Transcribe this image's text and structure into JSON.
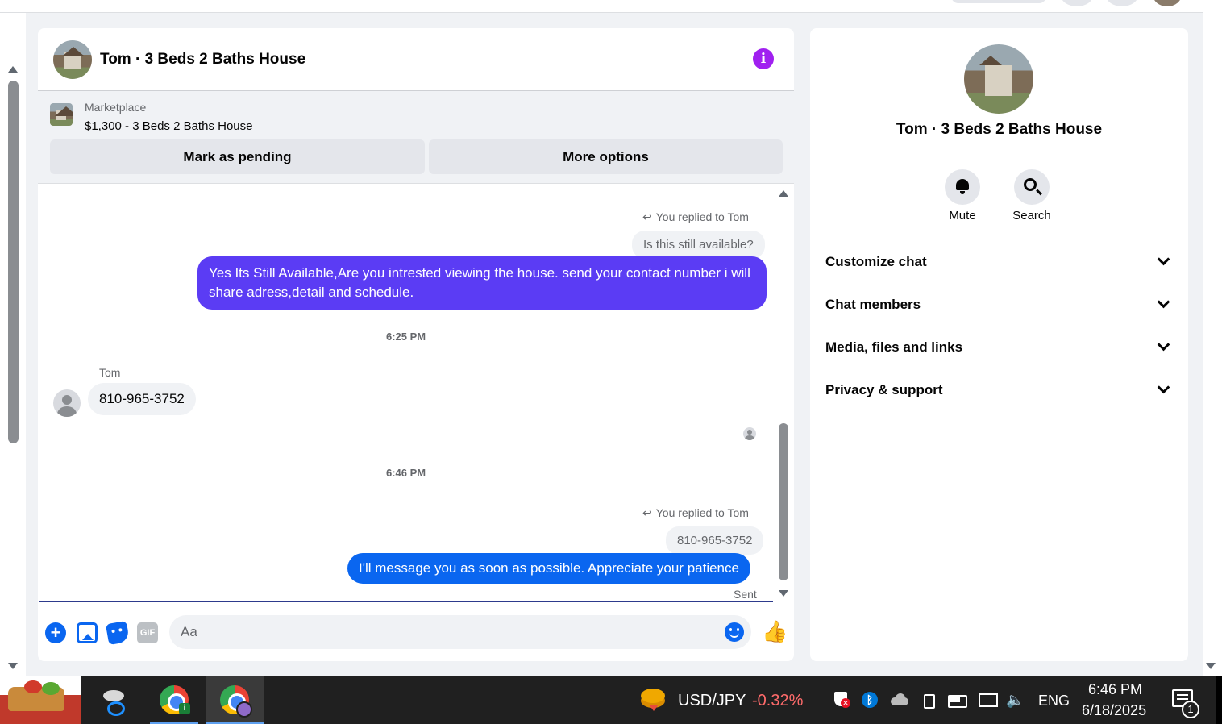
{
  "chat": {
    "title": "Tom · 3 Beds 2 Baths House",
    "marketplace": {
      "label": "Marketplace",
      "listing": "$1,300 - 3 Beds 2 Baths House",
      "mark_pending": "Mark as pending",
      "more_options": "More options"
    },
    "messages": {
      "reply1_note": "You replied to Tom",
      "reply1_quote": "Is this still available?",
      "reply1_text": "Yes Its Still Available,Are you intrested viewing the house. send your contact number i will share adress,detail and schedule.",
      "time1": "6:25 PM",
      "tom_sender": "Tom",
      "tom_text": "810-965-3752",
      "time2": "6:46 PM",
      "reply2_note": "You replied to Tom",
      "reply2_quote": "810-965-3752",
      "reply2_text": "I'll message you as soon as possible. Appreciate your patience",
      "status": "Sent"
    },
    "composer": {
      "placeholder": "Aa",
      "gif_label": "GIF"
    }
  },
  "info_panel": {
    "title": "Tom · 3 Beds 2 Baths House",
    "mute_label": "Mute",
    "search_label": "Search",
    "sections": [
      "Customize chat",
      "Chat members",
      "Media, files and links",
      "Privacy & support"
    ]
  },
  "taskbar": {
    "ticker_symbol": "USD/JPY",
    "ticker_change": "-0.32%",
    "language": "ENG",
    "time": "6:46 PM",
    "date": "6/18/2025",
    "notification_count": "1"
  },
  "colors": {
    "purple_bubble": "#5b3cf4",
    "blue_bubble": "#0a66f0",
    "info_icon": "#a020f0",
    "ticker_negative": "#ff6b6b"
  },
  "icons": [
    "info-icon",
    "reply-arrow-icon",
    "plus-icon",
    "photo-icon",
    "sticker-icon",
    "gif-icon",
    "emoji-icon",
    "like-icon",
    "bell-icon",
    "search-icon",
    "chevron-down-icon",
    "shield-icon",
    "bluetooth-icon",
    "cloud-icon",
    "camera-icon",
    "battery-icon",
    "network-icon",
    "volume-icon",
    "notification-icon"
  ]
}
